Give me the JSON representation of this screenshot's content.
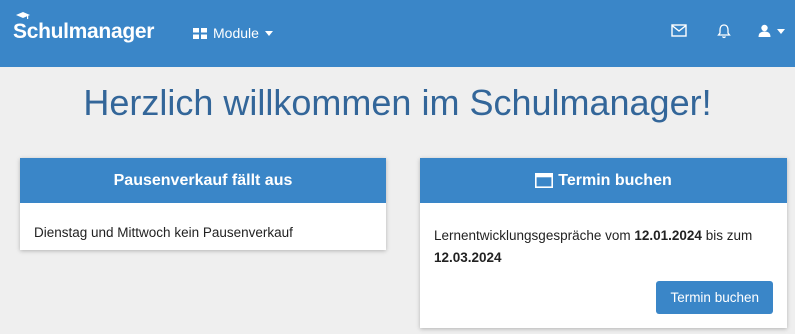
{
  "navbar": {
    "brand": "Schulmanager",
    "modules_label": "Module"
  },
  "headline": "Herzlich willkommen im Schulmanager!",
  "cards": {
    "pause": {
      "title": "Pausenverkauf fällt aus",
      "body": "Dienstag und Mittwoch kein Pausenverkauf"
    },
    "termin": {
      "title": "Termin buchen",
      "body_prefix": "Lernentwicklungsgespräche vom ",
      "date_start": "12.01.2024",
      "body_middle": " bis zum ",
      "date_end": "12.03.2024",
      "button_label": "Termin buchen"
    }
  },
  "colors": {
    "primary": "#3a86c8",
    "headline": "#336699",
    "background": "#efefef"
  },
  "icons": {
    "brand": "graduation-cap-icon",
    "modules": "grid-icon",
    "mail": "mail-icon",
    "notifications": "bell-icon",
    "user": "user-icon",
    "calendar": "calendar-icon"
  }
}
